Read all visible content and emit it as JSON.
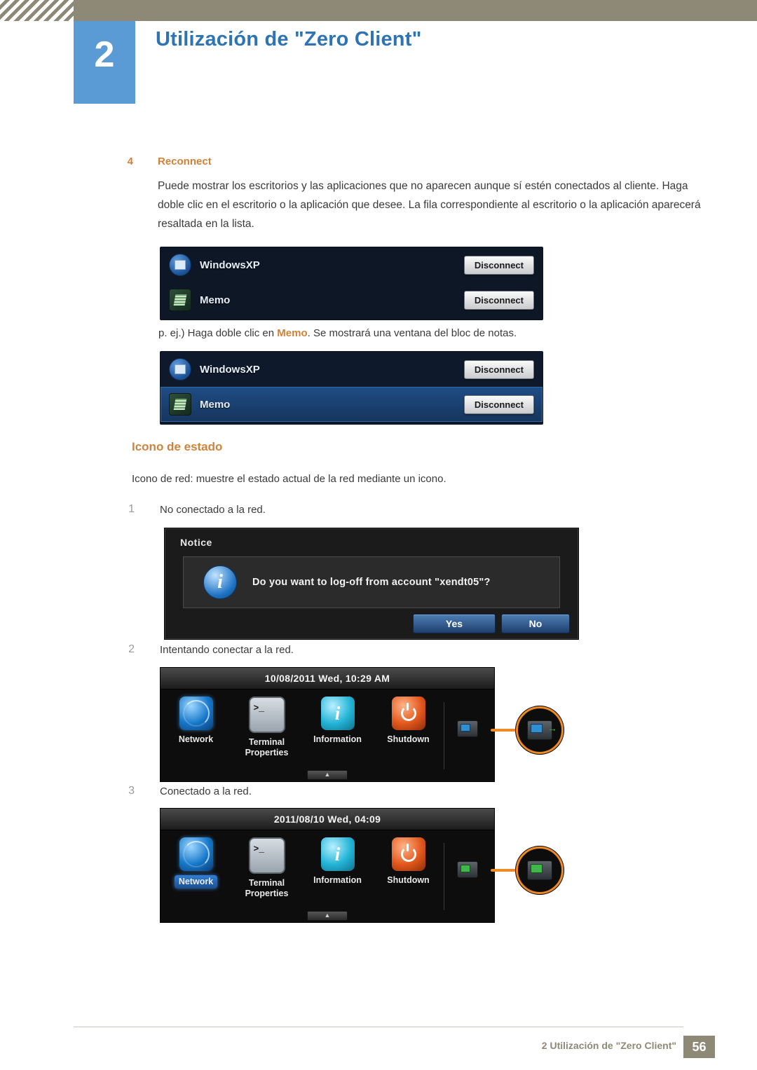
{
  "header": {
    "chapter_number": "2",
    "title": "Utilización de \"Zero Client\""
  },
  "content": {
    "step4_num": "4",
    "step4_label": "Reconnect",
    "step4_paragraph": "Puede mostrar los escritorios y las aplicaciones que no aparecen aunque sí estén conectados al cliente. Haga doble clic en el escritorio o la aplicación que desee. La fila correspondiente al escritorio o la aplicación aparecerá resaltada en la lista.",
    "example_prefix": "p. ej.) Haga doble clic en ",
    "example_bold": "Memo",
    "example_suffix": ". Se mostrará una ventana del bloc de notas.",
    "section_title": "Icono de estado",
    "section_intro": "Icono de red: muestre el estado actual de la red mediante un icono.",
    "items": [
      {
        "num": "1",
        "text": "No conectado a la red."
      },
      {
        "num": "2",
        "text": "Intentando conectar a la red."
      },
      {
        "num": "3",
        "text": "Conectado a la red."
      }
    ]
  },
  "conn_list_1": {
    "rows": [
      {
        "icon": "windows-icon",
        "name": "WindowsXP",
        "button": "Disconnect",
        "selected": false
      },
      {
        "icon": "memo-icon",
        "name": "Memo",
        "button": "Disconnect",
        "selected": false
      }
    ]
  },
  "conn_list_2": {
    "rows": [
      {
        "icon": "windows-icon",
        "name": "WindowsXP",
        "button": "Disconnect",
        "selected": false
      },
      {
        "icon": "memo-icon",
        "name": "Memo",
        "button": "Disconnect",
        "selected": true
      }
    ]
  },
  "notice_dialog": {
    "title": "Notice",
    "message": "Do you want to log-off from account \"xendt05\"?",
    "yes_label": "Yes",
    "no_label": "No"
  },
  "launcher_1": {
    "clock": "10/08/2011 Wed, 10:29 AM",
    "icons": [
      {
        "name": "Network",
        "glyph": "network-icon",
        "selected": false
      },
      {
        "name": "Terminal\nProperties",
        "line1": "Terminal",
        "line2": "Properties",
        "glyph": "terminal-icon",
        "selected": false
      },
      {
        "name": "Information",
        "line1": "Information",
        "line2": "",
        "glyph": "information-icon",
        "selected": false
      },
      {
        "name": "Shutdown",
        "line1": "Shutdown",
        "line2": "",
        "glyph": "shutdown-icon",
        "selected": false
      }
    ],
    "tray_state": "connecting"
  },
  "launcher_2": {
    "clock": "2011/08/10 Wed, 04:09",
    "icons": [
      {
        "name": "Network",
        "line1": "Network",
        "line2": "",
        "glyph": "network-icon",
        "selected": true
      },
      {
        "name": "Terminal Properties",
        "line1": "Terminal",
        "line2": "Properties",
        "glyph": "terminal-icon",
        "selected": false
      },
      {
        "name": "Information",
        "line1": "Information",
        "line2": "",
        "glyph": "information-icon",
        "selected": false
      },
      {
        "name": "Shutdown",
        "line1": "Shutdown",
        "line2": "",
        "glyph": "shutdown-icon",
        "selected": false
      }
    ],
    "tray_state": "connected"
  },
  "footer": {
    "text": "2 Utilización de \"Zero Client\"",
    "page": "56"
  },
  "colors": {
    "accent_orange": "#d1823a",
    "header_blue": "#2e74b5",
    "badge_blue": "#5b9bd5",
    "footer_khaki": "#8e8977"
  }
}
